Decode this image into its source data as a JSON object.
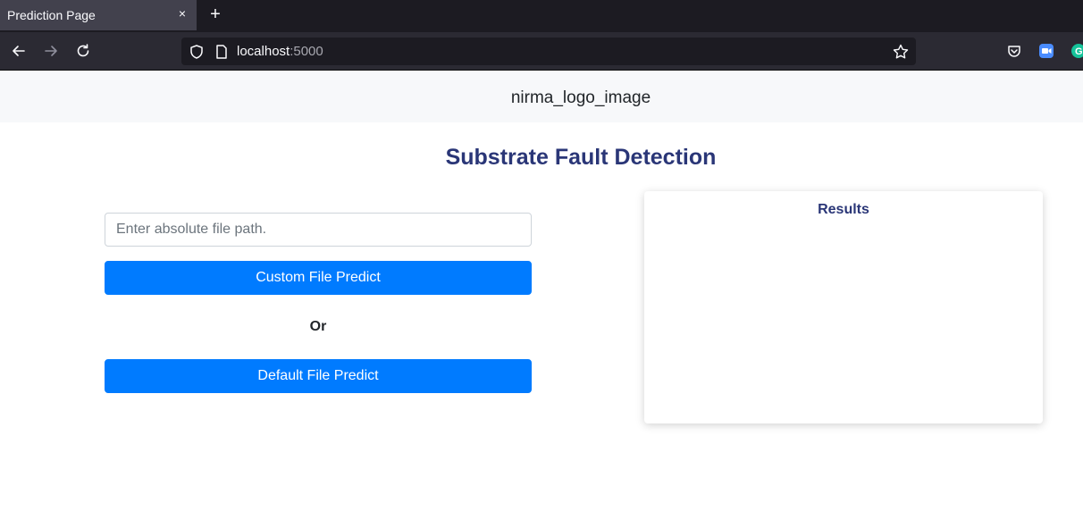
{
  "browser": {
    "tab_title": "Prediction Page",
    "tab_close": "×",
    "new_tab": "+",
    "url_host": "localhost",
    "url_port": ":5000",
    "icons": [
      "back-icon",
      "forward-icon",
      "reload-icon",
      "shield-icon",
      "page-icon",
      "star-icon",
      "pocket-icon",
      "zoom-extension-icon",
      "grammarly-extension-icon"
    ]
  },
  "header": {
    "logo_alt": "nirma_logo_image"
  },
  "main": {
    "title": "Substrate Fault Detection",
    "path_placeholder": "Enter absolute file path.",
    "path_value": "",
    "custom_predict_label": "Custom File Predict",
    "or_label": "Or",
    "default_predict_label": "Default File Predict"
  },
  "results": {
    "title": "Results"
  },
  "colors": {
    "primary_button": "#007bff",
    "heading": "#2a3677",
    "chrome_dark": "#1c1b22",
    "chrome_toolbar": "#2b2a33"
  }
}
